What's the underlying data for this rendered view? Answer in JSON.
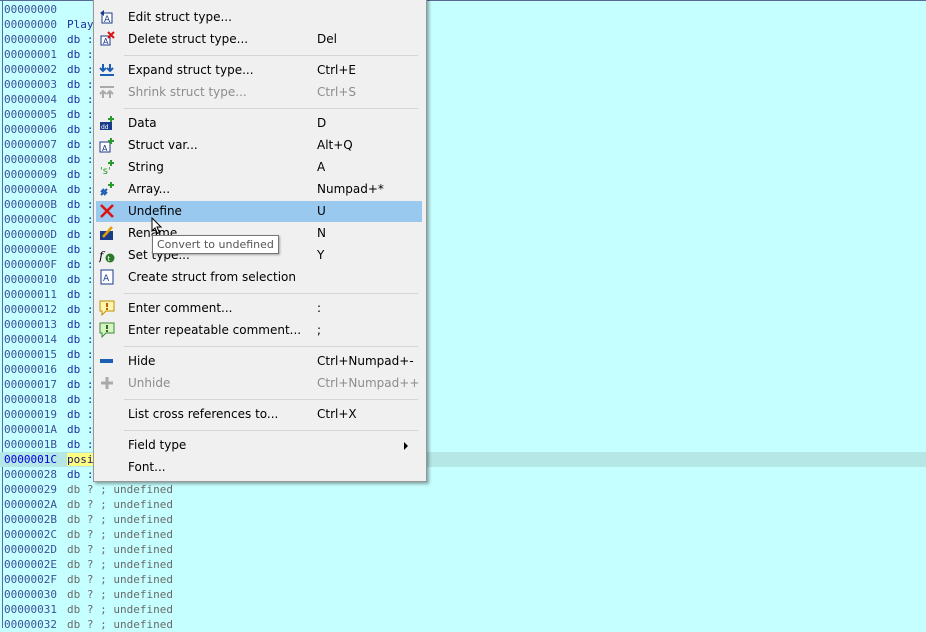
{
  "listing": {
    "rows": [
      {
        "addr": "00000000",
        "rest": ""
      },
      {
        "addr": "00000000",
        "rest": "Play"
      },
      {
        "addr": "00000000",
        "rest": "db :"
      },
      {
        "addr": "00000001",
        "rest": "db :"
      },
      {
        "addr": "00000002",
        "rest": "db :"
      },
      {
        "addr": "00000003",
        "rest": "db :"
      },
      {
        "addr": "00000004",
        "rest": "db :"
      },
      {
        "addr": "00000005",
        "rest": "db :"
      },
      {
        "addr": "00000006",
        "rest": "db :"
      },
      {
        "addr": "00000007",
        "rest": "db :"
      },
      {
        "addr": "00000008",
        "rest": "db :"
      },
      {
        "addr": "00000009",
        "rest": "db :"
      },
      {
        "addr": "0000000A",
        "rest": "db :"
      },
      {
        "addr": "0000000B",
        "rest": "db :"
      },
      {
        "addr": "0000000C",
        "rest": "db :"
      },
      {
        "addr": "0000000D",
        "rest": "db :"
      },
      {
        "addr": "0000000E",
        "rest": "db :"
      },
      {
        "addr": "0000000F",
        "rest": "db :"
      },
      {
        "addr": "00000010",
        "rest": "db :"
      },
      {
        "addr": "00000011",
        "rest": "db :"
      },
      {
        "addr": "00000012",
        "rest": "db :"
      },
      {
        "addr": "00000013",
        "rest": "db :"
      },
      {
        "addr": "00000014",
        "rest": "db :"
      },
      {
        "addr": "00000015",
        "rest": "db :"
      },
      {
        "addr": "00000016",
        "rest": "db :"
      },
      {
        "addr": "00000017",
        "rest": "db :"
      },
      {
        "addr": "00000018",
        "rest": "db :"
      },
      {
        "addr": "00000019",
        "rest": "db :"
      },
      {
        "addr": "0000001A",
        "rest": "db :"
      },
      {
        "addr": "0000001B",
        "rest": "db :"
      },
      {
        "addr": "0000001C",
        "rest": "posi"
      },
      {
        "addr": "00000028",
        "rest": "db :"
      },
      {
        "addr": "00000029",
        "rest": "db ? ; undefined"
      },
      {
        "addr": "0000002A",
        "rest": "db ? ; undefined"
      },
      {
        "addr": "0000002B",
        "rest": "db ? ; undefined"
      },
      {
        "addr": "0000002C",
        "rest": "db ? ; undefined"
      },
      {
        "addr": "0000002D",
        "rest": "db ? ; undefined"
      },
      {
        "addr": "0000002E",
        "rest": "db ? ; undefined"
      },
      {
        "addr": "0000002F",
        "rest": "db ? ; undefined"
      },
      {
        "addr": "00000030",
        "rest": "db ? ; undefined"
      },
      {
        "addr": "00000031",
        "rest": "db ? ; undefined"
      },
      {
        "addr": "00000032",
        "rest": "db ? ; undefined"
      }
    ]
  },
  "menu": {
    "items": [
      {
        "label": "Edit struct type...",
        "shortcut": "",
        "icon": "edit-struct-icon",
        "disabled": false
      },
      {
        "label": "Delete struct type...",
        "shortcut": "Del",
        "icon": "delete-struct-icon",
        "disabled": false
      },
      {
        "label": "Expand struct type...",
        "shortcut": "Ctrl+E",
        "icon": "expand-icon",
        "disabled": false
      },
      {
        "label": "Shrink struct type...",
        "shortcut": "Ctrl+S",
        "icon": "shrink-icon",
        "disabled": true
      },
      {
        "label": "Data",
        "shortcut": "D",
        "icon": "data-icon",
        "disabled": false
      },
      {
        "label": "Struct var...",
        "shortcut": "Alt+Q",
        "icon": "struct-var-icon",
        "disabled": false
      },
      {
        "label": "String",
        "shortcut": "A",
        "icon": "string-icon",
        "disabled": false
      },
      {
        "label": "Array...",
        "shortcut": "Numpad+*",
        "icon": "array-icon",
        "disabled": false
      },
      {
        "label": "Undefine",
        "shortcut": "U",
        "icon": "undefine-x-icon",
        "disabled": false
      },
      {
        "label": "Rename",
        "shortcut": "N",
        "icon": "rename-icon",
        "disabled": false
      },
      {
        "label": "Set type...",
        "shortcut": "Y",
        "icon": "set-type-icon",
        "disabled": false
      },
      {
        "label": "Create struct from selection",
        "shortcut": "",
        "icon": "create-struct-icon",
        "disabled": false
      },
      {
        "label": "Enter comment...",
        "shortcut": ":",
        "icon": "comment-icon",
        "disabled": false
      },
      {
        "label": "Enter repeatable comment...",
        "shortcut": ";",
        "icon": "repeatable-comment-icon",
        "disabled": false
      },
      {
        "label": "Hide",
        "shortcut": "Ctrl+Numpad+-",
        "icon": "hide-minus-icon",
        "disabled": false
      },
      {
        "label": "Unhide",
        "shortcut": "Ctrl+Numpad++",
        "icon": "unhide-plus-icon",
        "disabled": true
      },
      {
        "label": "List cross references to...",
        "shortcut": "Ctrl+X",
        "icon": "",
        "disabled": false
      },
      {
        "label": "Field type",
        "shortcut": "",
        "icon": "",
        "disabled": false
      },
      {
        "label": "Font...",
        "shortcut": "",
        "icon": "",
        "disabled": false
      }
    ],
    "highlighted": "Undefine"
  },
  "tooltip": {
    "text": "Convert to undefined"
  },
  "colors": {
    "listing_bg": "#c6ffff",
    "highlight": "#99c9ef",
    "menu_bg": "#f0f0f0"
  }
}
